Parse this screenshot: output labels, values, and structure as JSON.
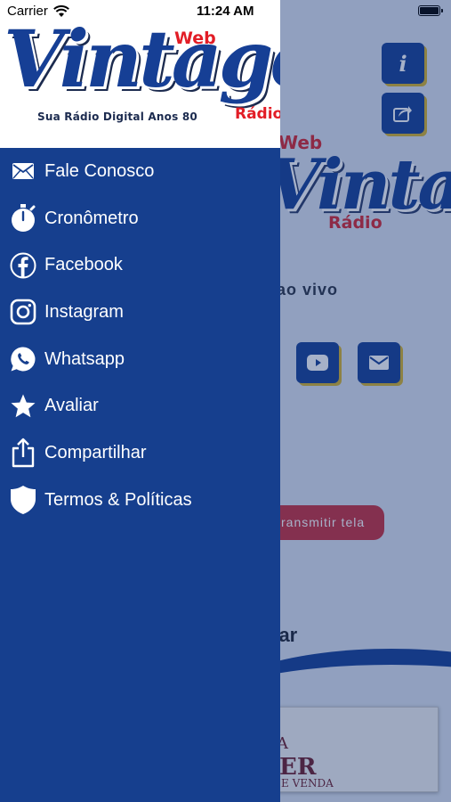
{
  "status_bar": {
    "carrier": "Carrier",
    "time": "11:24 AM"
  },
  "logo": {
    "web": "Web",
    "vintage": "Vintage",
    "radio": "Rádio",
    "tagline": "Sua Rádio Digital Anos 80"
  },
  "menu": {
    "items": [
      {
        "label": "Fale Conosco",
        "icon": "envelope-icon"
      },
      {
        "label": "Cronômetro",
        "icon": "stopwatch-icon"
      },
      {
        "label": "Facebook",
        "icon": "facebook-icon"
      },
      {
        "label": "Instagram",
        "icon": "instagram-icon"
      },
      {
        "label": "Whatsapp",
        "icon": "whatsapp-icon"
      },
      {
        "label": "Avaliar",
        "icon": "star-icon"
      },
      {
        "label": "Compartilhar",
        "icon": "share-icon"
      },
      {
        "label": "Termos & Políticas",
        "icon": "shield-icon"
      }
    ]
  },
  "background": {
    "logo_web": "Web",
    "logo_vintage": "Vintage",
    "logo_radio": "Rádio",
    "live_text": "ao vivo",
    "transmit_button": "ransmitir tela",
    "schedule_title": "dar",
    "card_text_a": "A",
    "card_text_b": "ER",
    "card_text_c": "E VENDA"
  },
  "colors": {
    "drawer": "#163f8e",
    "brand_blue": "#163f95",
    "brand_red": "#e21d26",
    "button_shadow": "#d7b32a"
  }
}
